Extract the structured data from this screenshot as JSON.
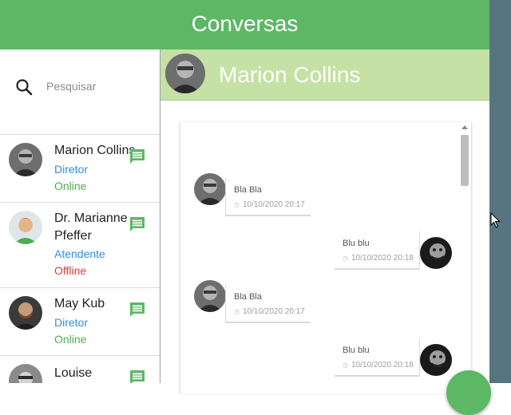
{
  "header": {
    "title": "Conversas"
  },
  "search": {
    "placeholder": "Pesquisar"
  },
  "contacts": [
    {
      "name": "Marion Collins",
      "role": "Diretor",
      "status": "Online"
    },
    {
      "name": "Dr. Marianne Pfeffer",
      "role": "Atendente",
      "status": "Offline"
    },
    {
      "name": "May Kub",
      "role": "Diretor",
      "status": "Online"
    },
    {
      "name": "Louise",
      "role": "",
      "status": ""
    }
  ],
  "chat": {
    "contact_name": "Marion Collins",
    "messages": [
      {
        "side": "left",
        "text": "Bla Bla",
        "time": "10/10/2020 20:17"
      },
      {
        "side": "right",
        "text": "Blu blu",
        "time": "10/10/2020 20:18"
      },
      {
        "side": "left",
        "text": "Bla Bla",
        "time": "10/10/2020 20:17"
      },
      {
        "side": "right",
        "text": "Blu blu",
        "time": "10/10/2020 20:18"
      }
    ]
  },
  "colors": {
    "primary": "#5cb865",
    "chat_header": "#c5e1a5",
    "role": "#2f8de0",
    "online": "#4caf50",
    "offline": "#e53935"
  }
}
